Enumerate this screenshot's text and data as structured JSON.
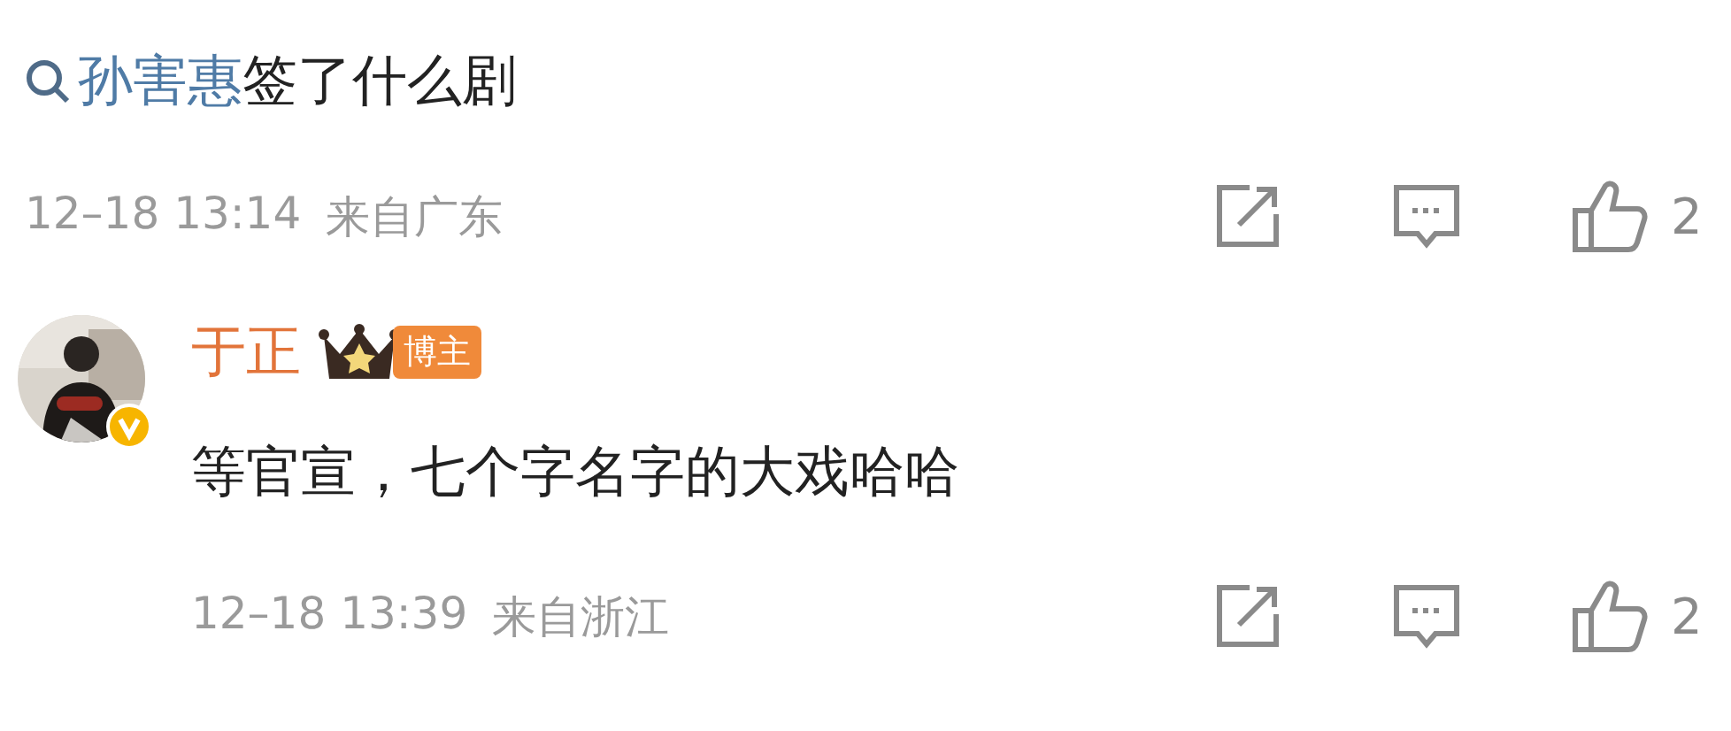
{
  "comment": {
    "query_link": "孙害惠",
    "text": "签了什么剧",
    "time": "12–18 13:14",
    "location": "来自广东",
    "likes": "2"
  },
  "reply": {
    "author": "于正",
    "verified": true,
    "tag": "博主",
    "text": "等官宣，七个字名字的大戏哈哈",
    "time": "12–18 13:39",
    "location": "来自浙江",
    "likes": "2"
  }
}
